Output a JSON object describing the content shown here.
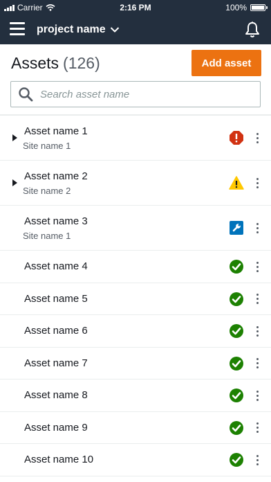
{
  "status_bar": {
    "carrier": "Carrier",
    "time": "2:16 PM",
    "battery": "100%",
    "battery_level": 1.0
  },
  "navbar": {
    "project_name": "project name",
    "menu_icon": "hamburger-icon",
    "notification_icon": "bell-icon"
  },
  "header": {
    "title": "Assets",
    "count": "(126)",
    "add_label": "Add asset"
  },
  "search": {
    "placeholder": "Search asset name",
    "value": ""
  },
  "colors": {
    "nav_bg": "#232f3e",
    "accent": "#ec7211",
    "error": "#d13212",
    "warning": "#ffc800",
    "maintenance": "#0073bb",
    "ok": "#1d8102"
  },
  "assets": [
    {
      "name": "Asset name 1",
      "site": "Site name 1",
      "status": "error",
      "expandable": true
    },
    {
      "name": "Asset name 2",
      "site": "Site name 2",
      "status": "warning",
      "expandable": true
    },
    {
      "name": "Asset name 3",
      "site": "Site name 1",
      "status": "maintenance",
      "expandable": false
    },
    {
      "name": "Asset name 4",
      "site": "",
      "status": "ok",
      "expandable": false
    },
    {
      "name": "Asset name 5",
      "site": "",
      "status": "ok",
      "expandable": false
    },
    {
      "name": "Asset name 6",
      "site": "",
      "status": "ok",
      "expandable": false
    },
    {
      "name": "Asset name 7",
      "site": "",
      "status": "ok",
      "expandable": false
    },
    {
      "name": "Asset name 8",
      "site": "",
      "status": "ok",
      "expandable": false
    },
    {
      "name": "Asset name 9",
      "site": "",
      "status": "ok",
      "expandable": false
    },
    {
      "name": "Asset name 10",
      "site": "",
      "status": "ok",
      "expandable": false
    }
  ]
}
